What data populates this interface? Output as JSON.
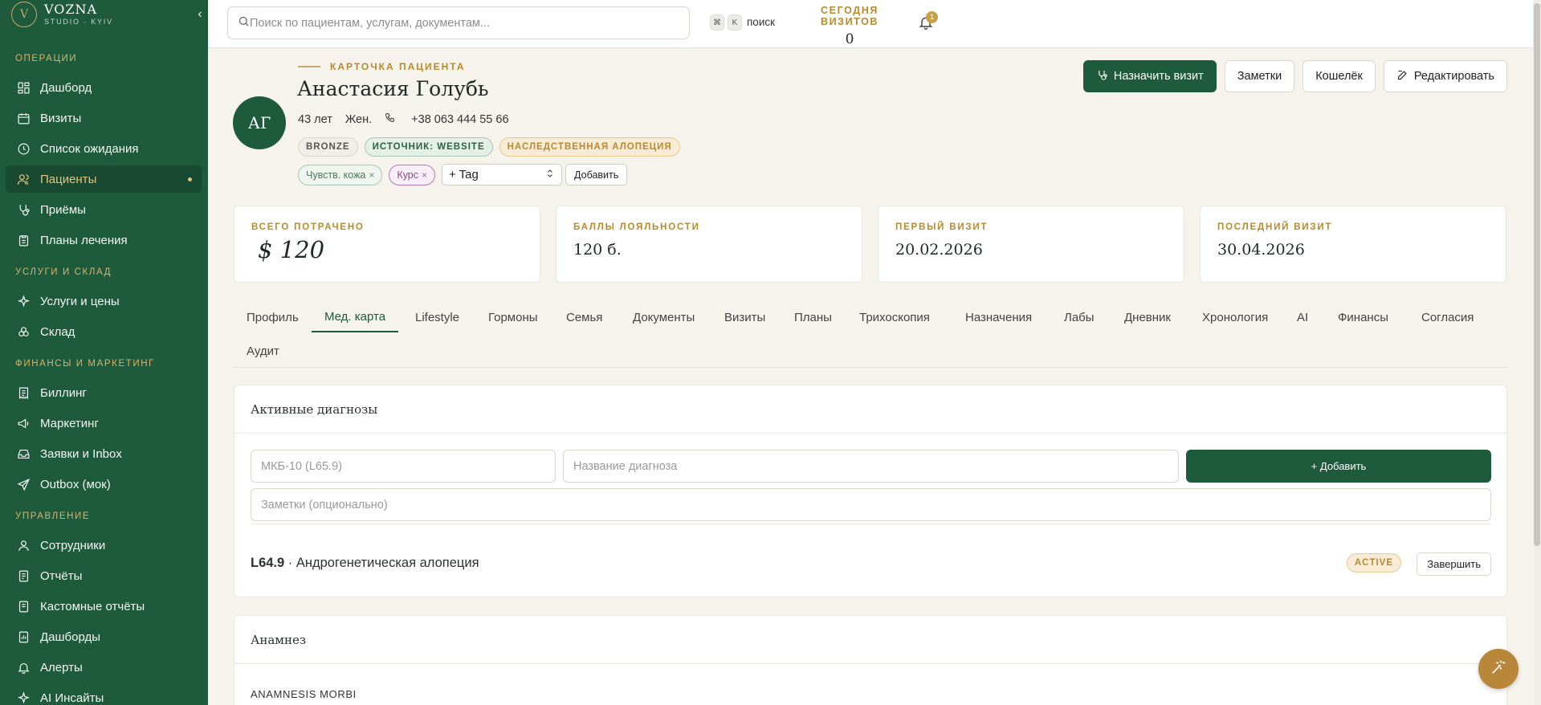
{
  "brand": {
    "name": "VOZNA",
    "subtitle": "STUDIO · KYIV",
    "mark": "V"
  },
  "sidebar": {
    "collapse_glyph": "‹",
    "sections": [
      {
        "title": "Операции",
        "items": [
          {
            "label": "Дашборд",
            "icon": "dashboard-icon"
          },
          {
            "label": "Визиты",
            "icon": "calendar-icon"
          },
          {
            "label": "Список ожидания",
            "icon": "clock-icon"
          },
          {
            "label": "Пациенты",
            "icon": "users-icon",
            "active": true
          },
          {
            "label": "Приёмы",
            "icon": "stethoscope-icon"
          },
          {
            "label": "Планы лечения",
            "icon": "clipboard-icon"
          }
        ]
      },
      {
        "title": "Услуги и склад",
        "items": [
          {
            "label": "Услуги и цены",
            "icon": "sparkle-icon"
          },
          {
            "label": "Склад",
            "icon": "boxes-icon"
          }
        ]
      },
      {
        "title": "Финансы и маркетинг",
        "items": [
          {
            "label": "Биллинг",
            "icon": "receipt-icon"
          },
          {
            "label": "Маркетинг",
            "icon": "megaphone-icon"
          },
          {
            "label": "Заявки и Inbox",
            "icon": "inbox-icon"
          },
          {
            "label": "Outbox (мок)",
            "icon": "send-icon"
          }
        ]
      },
      {
        "title": "Управление",
        "items": [
          {
            "label": "Сотрудники",
            "icon": "user-icon"
          },
          {
            "label": "Отчёты",
            "icon": "report-icon"
          },
          {
            "label": "Кастомные отчёты",
            "icon": "report-custom-icon"
          },
          {
            "label": "Дашборды",
            "icon": "dashboards-icon"
          },
          {
            "label": "Алерты",
            "icon": "bell-icon"
          },
          {
            "label": "AI Инсайты",
            "icon": "ai-icon"
          }
        ]
      }
    ]
  },
  "topbar": {
    "search_placeholder": "Поиск по пациентам, услугам, документам...",
    "kbd_cmd": "⌘",
    "kbd_k": "K",
    "kbd_label": "поиск",
    "today_label": "СЕГОДНЯ ВИЗИТОВ",
    "today_value": "0",
    "notifications_count": "1"
  },
  "patient": {
    "eyebrow": "КАРТОЧКА ПАЦИЕНТА",
    "initials": "АГ",
    "name": "Анастасия Голубь",
    "age": "43 лет",
    "sex": "Жен.",
    "phone": "+38 063 444 55 66",
    "badges": [
      "BRONZE",
      "ИСТОЧНИК: WEBSITE",
      "НАСЛЕДСТВЕННАЯ АЛОПЕЦИЯ"
    ],
    "tags": [
      "Чувств. кожа",
      "Курс"
    ],
    "tag_remove_glyph": "×",
    "tag_select_value": "+ Tag",
    "tag_add_label": "Добавить"
  },
  "actions": {
    "schedule": "Назначить визит",
    "notes": "Заметки",
    "wallet": "Кошелёк",
    "edit": "Редактировать"
  },
  "stats": [
    {
      "label": "ВСЕГО ПОТРАЧЕНО",
      "value": "$ 120"
    },
    {
      "label": "БАЛЛЫ ЛОЯЛЬНОСТИ",
      "value": "120 б."
    },
    {
      "label": "ПЕРВЫЙ ВИЗИТ",
      "value": "20.02.2026"
    },
    {
      "label": "ПОСЛЕДНИЙ ВИЗИТ",
      "value": "30.04.2026"
    }
  ],
  "tabs": [
    "Профиль",
    "Мед. карта",
    "Lifestyle",
    "Гормоны",
    "Семья",
    "Документы",
    "Визиты",
    "Планы",
    "Трихоскопия",
    "Назначения",
    "Лабы",
    "Дневник",
    "Хронология",
    "AI",
    "Финансы",
    "Согласия",
    "Аудит"
  ],
  "active_tab": "Мед. карта",
  "diagnoses": {
    "title": "Активные диагнозы",
    "icd_placeholder": "МКБ-10 (L65.9)",
    "name_placeholder": "Название диагноза",
    "notes_placeholder": "Заметки (опционально)",
    "add_label": "+ Добавить",
    "items": [
      {
        "code": "L64.9",
        "separator": " · ",
        "name": "Андрогенетическая алопеция",
        "status": "ACTIVE",
        "action": "Завершить"
      }
    ]
  },
  "anamnesis": {
    "title": "Анамнез",
    "first_label": "ANAMNESIS MORBI"
  },
  "colors": {
    "sidebar_bg": "#1e5a3c",
    "accent_gold": "#b88a2e",
    "primary_green": "#1e5a3c",
    "page_bg": "#f6f3ec"
  }
}
